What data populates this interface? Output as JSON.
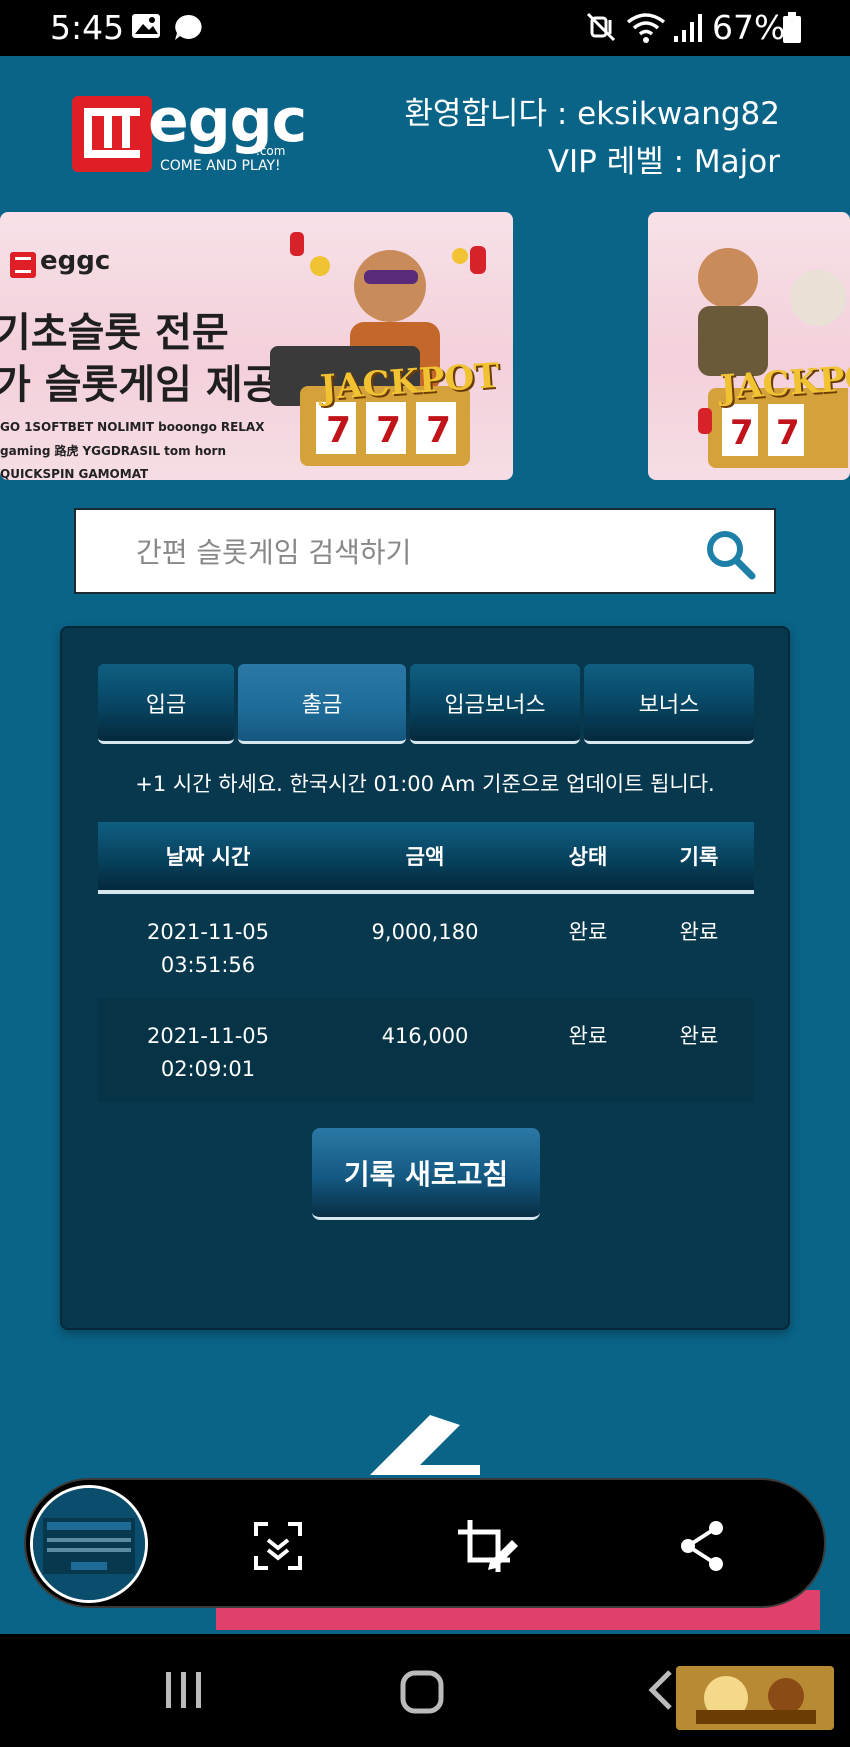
{
  "status_bar": {
    "time": "5:45",
    "battery_pct": "67%",
    "icons": [
      "gallery-icon",
      "chat-icon",
      "mute-icon",
      "wifi-icon",
      "signal-icon",
      "battery-icon"
    ]
  },
  "header": {
    "brand": "eggc",
    "brand_suffix": ".com",
    "brand_tagline": "COME AND PLAY!",
    "welcome": "환영합니다 : eksikwang82",
    "vip": "VIP 레벨 : Major"
  },
  "banners": [
    {
      "brand": "eggc",
      "headline_1": "기초슬롯 전문",
      "headline_2": "가 슬롯게임 제공",
      "jackpot": "JACKPOT",
      "providers": [
        "GO",
        "1SOFTBET",
        "NOLIMIT",
        "booongo",
        "RELAX",
        "gaming",
        "路虎",
        "YGGDRASIL",
        "tom horn",
        "QUICKSPIN",
        "GAMOMAT"
      ]
    },
    {
      "jackpot": "JACKPOT"
    }
  ],
  "search": {
    "placeholder": "간편 슬롯게임 검색하기"
  },
  "panel": {
    "tabs": [
      {
        "label": "입금",
        "active": false
      },
      {
        "label": "출금",
        "active": true
      },
      {
        "label": "입금보너스",
        "active": false
      },
      {
        "label": "보너스",
        "active": false
      }
    ],
    "notice": "+1 시간 하세요. 한국시간 01:00 Am 기준으로 업데이트 됩니다.",
    "table": {
      "headers": [
        "날짜 시간",
        "금액",
        "상태",
        "기록"
      ],
      "rows": [
        {
          "date": "2021-11-05",
          "time": "03:51:56",
          "amount": "9,000,180",
          "status": "완료",
          "record": "완료"
        },
        {
          "date": "2021-11-05",
          "time": "02:09:01",
          "amount": "416,000",
          "status": "완료",
          "record": "완료"
        }
      ]
    },
    "refresh_label": "기록 새로고침"
  },
  "toolbar": {
    "tools": [
      "scroll-capture-icon",
      "crop-edit-icon",
      "share-icon"
    ]
  },
  "colors": {
    "background": "#0a6488",
    "panel": "#08384e",
    "tab_active": "#1e6b98",
    "accent_logo": "#e01e26",
    "search_icon": "#1e7fa8"
  }
}
